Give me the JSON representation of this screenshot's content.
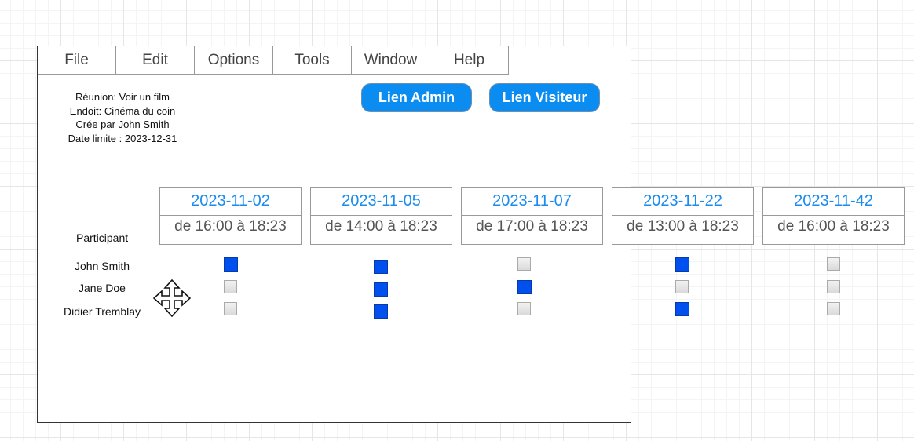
{
  "menu": [
    "File",
    "Edit",
    "Options",
    "Tools",
    "Window",
    "Help"
  ],
  "info": {
    "line1": "Réunion: Voir un film",
    "line2": "Endoit: Cinéma du coin",
    "line3": "Crée par John Smith",
    "line4": "Date limite : 2023-12-31"
  },
  "buttons": {
    "admin": "Lien Admin",
    "visitor": "Lien Visiteur"
  },
  "participant_header": "Participant",
  "dates": [
    {
      "date": "2023-11-02",
      "time": "de 16:00 à 18:23"
    },
    {
      "date": "2023-11-05",
      "time": "de 14:00 à 18:23"
    },
    {
      "date": "2023-11-07",
      "time": "de 17:00 à 18:23"
    },
    {
      "date": "2023-11-22",
      "time": "de 13:00 à 18:23"
    },
    {
      "date": "2023-11-42",
      "time": "de 16:00 à 18:23"
    }
  ],
  "participants": [
    {
      "name": "John Smith",
      "checks": [
        true,
        true,
        false,
        true,
        false
      ]
    },
    {
      "name": "Jane Doe",
      "checks": [
        false,
        true,
        true,
        false,
        false
      ]
    },
    {
      "name": "Didier Tremblay",
      "checks": [
        false,
        true,
        false,
        true,
        false
      ]
    }
  ],
  "colors": {
    "accent": "#0a8cf0",
    "checked": "#0050ef",
    "date_text": "#1a8cf0"
  },
  "icons": {
    "move": "move-cursor-icon"
  }
}
